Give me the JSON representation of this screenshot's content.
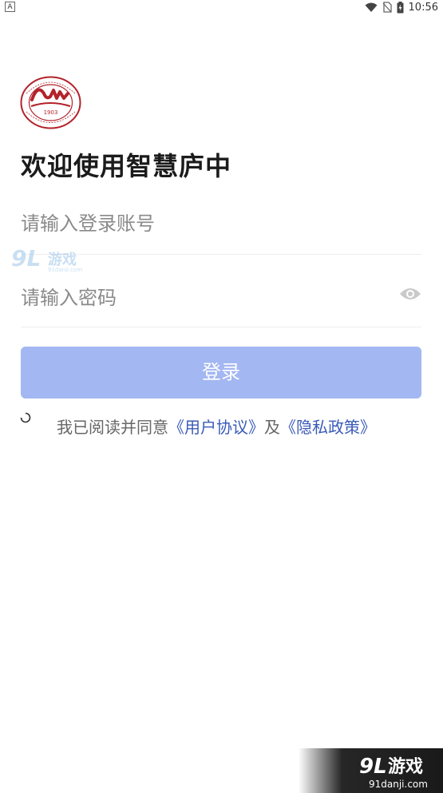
{
  "status_bar": {
    "notification": "A",
    "time": "10:56"
  },
  "header": {
    "title": "欢迎使用智慧庐中",
    "logo_year": "1903"
  },
  "form": {
    "account_placeholder": "请输入登录账号",
    "password_placeholder": "请输入密码",
    "login_label": "登录"
  },
  "agreement": {
    "prefix": "我已阅读并同意",
    "user_agreement": "《用户协议》",
    "connector": "及",
    "privacy_policy": "《隐私政策》"
  },
  "watermark": {
    "text": "游戏",
    "site": "91danji.com",
    "brand": "9L"
  },
  "colors": {
    "button": "#a3b7f2",
    "link": "#3a5bb8",
    "logo_red": "#b3222a"
  }
}
